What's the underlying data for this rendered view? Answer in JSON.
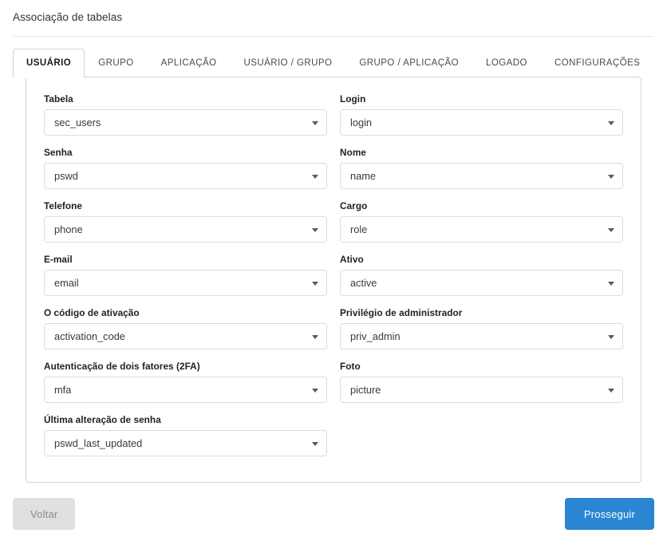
{
  "header": {
    "title": "Associação de tabelas"
  },
  "tabs": [
    {
      "label": "USUÁRIO",
      "active": true
    },
    {
      "label": "GRUPO",
      "active": false
    },
    {
      "label": "APLICAÇÃO",
      "active": false
    },
    {
      "label": "USUÁRIO / GRUPO",
      "active": false
    },
    {
      "label": "GRUPO / APLICAÇÃO",
      "active": false
    },
    {
      "label": "LOGADO",
      "active": false
    },
    {
      "label": "CONFIGURAÇÕES",
      "active": false
    }
  ],
  "form": {
    "left_column": [
      {
        "label": "Tabela",
        "value": "sec_users"
      },
      {
        "label": "Senha",
        "value": "pswd"
      },
      {
        "label": "Telefone",
        "value": "phone"
      },
      {
        "label": "E-mail",
        "value": "email"
      },
      {
        "label": "O código de ativação",
        "value": "activation_code"
      },
      {
        "label": "Autenticação de dois fatores (2FA)",
        "value": "mfa"
      },
      {
        "label": "Última alteração de senha",
        "value": "pswd_last_updated"
      }
    ],
    "right_column": [
      {
        "label": "Login",
        "value": "login"
      },
      {
        "label": "Nome",
        "value": "name"
      },
      {
        "label": "Cargo",
        "value": "role"
      },
      {
        "label": "Ativo",
        "value": "active"
      },
      {
        "label": "Privilégio de administrador",
        "value": "priv_admin"
      },
      {
        "label": "Foto",
        "value": "picture"
      }
    ]
  },
  "footer": {
    "back_label": "Voltar",
    "next_label": "Prosseguir"
  },
  "icons": {
    "select_caret": "chevron-down-icon"
  },
  "colors": {
    "primary": "#2a86d3",
    "back_button_bg": "#e0e0e0",
    "back_button_text": "#8a8a8a",
    "border": "#d4d4d4",
    "field_border": "#dcdcdc",
    "label_text": "#222222",
    "value_text": "#3a3a3a"
  }
}
